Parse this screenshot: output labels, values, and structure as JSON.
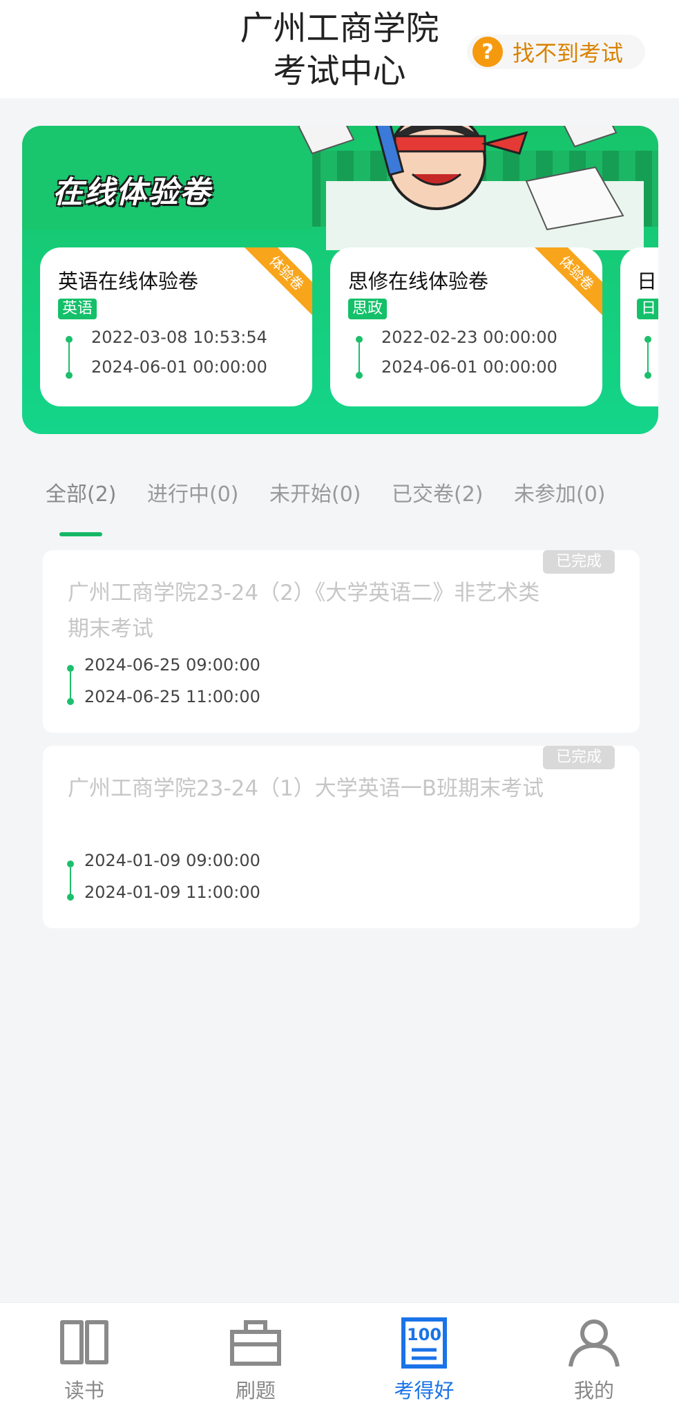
{
  "header": {
    "title_line1": "广州工商学院",
    "title_line2": "考试中心",
    "help_label": "找不到考试",
    "help_icon": "question-icon"
  },
  "banner": {
    "title": "在线体验卷",
    "cards": [
      {
        "title": "英语在线体验卷",
        "tag": "英语",
        "ribbon": "体验卷",
        "start": "2022-03-08 10:53:54",
        "end": "2024-06-01 00:00:00"
      },
      {
        "title": "思修在线体验卷",
        "tag": "思政",
        "ribbon": "体验卷",
        "start": "2022-02-23 00:00:00",
        "end": "2024-06-01 00:00:00"
      },
      {
        "title": "日",
        "tag": "日",
        "ribbon": "",
        "start": "",
        "end": ""
      }
    ]
  },
  "tabs": [
    {
      "label": "全部(2)",
      "active": true
    },
    {
      "label": "进行中(0)",
      "active": false
    },
    {
      "label": "未开始(0)",
      "active": false
    },
    {
      "label": "已交卷(2)",
      "active": false
    },
    {
      "label": "未参加(0)",
      "active": false
    }
  ],
  "exams": [
    {
      "title": "广州工商学院23-24（2）《大学英语二》非艺术类期末考试",
      "status": "已完成",
      "start": "2024-06-25 09:00:00",
      "end": "2024-06-25 11:00:00"
    },
    {
      "title": "广州工商学院23-24（1）大学英语一B班期末考试",
      "status": "已完成",
      "start": "2024-01-09 09:00:00",
      "end": "2024-01-09 11:00:00"
    }
  ],
  "nav": [
    {
      "label": "读书",
      "icon": "book-icon",
      "active": false
    },
    {
      "label": "刷题",
      "icon": "toolbox-icon",
      "active": false
    },
    {
      "label": "考得好",
      "icon": "score-100-icon",
      "active": true
    },
    {
      "label": "我的",
      "icon": "person-icon",
      "active": false
    }
  ],
  "colors": {
    "accent_green": "#14b864",
    "active_blue": "#1a73e8",
    "help_orange": "#f59a0f",
    "ribbon_orange": "#f8a51b"
  }
}
